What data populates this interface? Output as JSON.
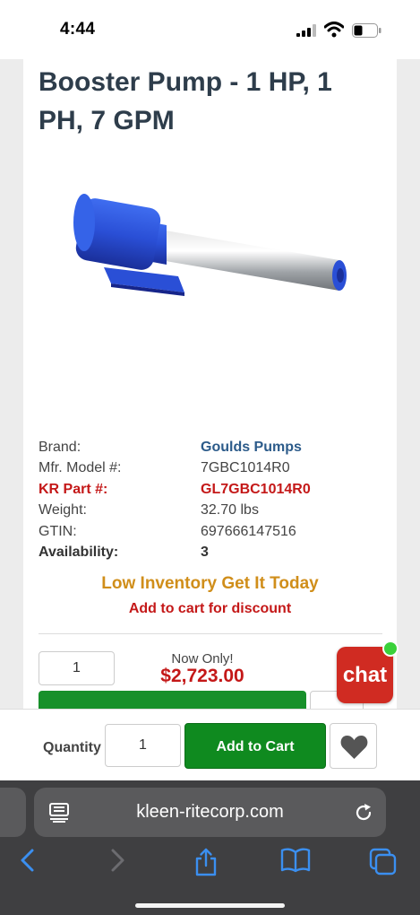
{
  "status": {
    "time": "4:44"
  },
  "product": {
    "title": "Booster Pump - 1 HP, 1 PH, 7 GPM",
    "specs": [
      {
        "label": "Brand:",
        "value": "Goulds Pumps"
      },
      {
        "label": "Mfr. Model #:",
        "value": "7GBC1014R0"
      },
      {
        "label": "KR Part #:",
        "value": "GL7GBC1014R0"
      },
      {
        "label": "Weight:",
        "value": "32.70 lbs"
      },
      {
        "label": "GTIN:",
        "value": "697666147516"
      },
      {
        "label": "Availability:",
        "value": "3"
      }
    ],
    "low_inventory": "Low Inventory Get It Today",
    "add_discount": "Add to cart for discount",
    "quantity_value": "1",
    "now_only": "Now Only!",
    "price": "$2,723.00"
  },
  "chat": {
    "label": "chat"
  },
  "sticky": {
    "quantity_label": "Quantity",
    "quantity_value": "1",
    "add_to_cart": "Add to Cart"
  },
  "browser": {
    "url": "kleen-ritecorp.com"
  },
  "colors": {
    "title": "#2e3d4b",
    "brand_link": "#2c5b8a",
    "part_red": "#c41818",
    "low_inventory_orange": "#d08e1a",
    "add_to_cart_green": "#0f8a1f",
    "chat_red": "#d02b22",
    "chat_online": "#3ad13a",
    "safari_bar": "#3f3f41",
    "safari_icon_blue": "#3b8ff0"
  }
}
